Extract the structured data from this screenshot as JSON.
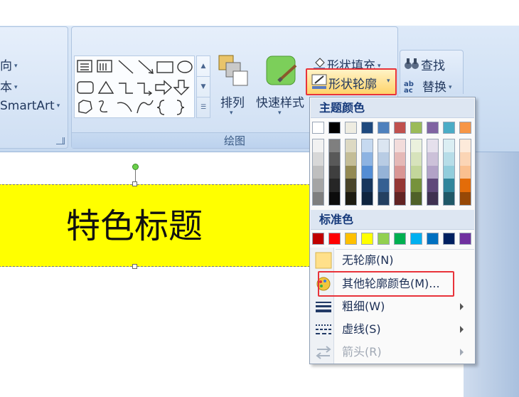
{
  "ribbon": {
    "left_group": {
      "items": [
        "向",
        "本",
        "SmartArt"
      ]
    },
    "drawing_group": {
      "caption": "绘图",
      "arrange_label": "排列",
      "quick_styles_label": "快速样式",
      "shape_fill_label": "形状填充",
      "shape_outline_label": "形状轮廓"
    },
    "editing_group": {
      "find_label": "查找",
      "replace_label": "替换"
    }
  },
  "slide": {
    "title_text": "特色标题",
    "title_fill": "#ffff00"
  },
  "dropdown": {
    "theme_colors_header": "主题颜色",
    "standard_colors_header": "标准色",
    "theme_colors": [
      "#ffffff",
      "#000000",
      "#eeece1",
      "#1f497d",
      "#4f81bd",
      "#c0504d",
      "#9bbb59",
      "#8064a2",
      "#4bacc6",
      "#f79646"
    ],
    "theme_tints": [
      [
        "#f2f2f2",
        "#d8d8d8",
        "#bfbfbf",
        "#a5a5a5",
        "#7f7f7f"
      ],
      [
        "#7f7f7f",
        "#595959",
        "#3f3f3f",
        "#262626",
        "#0c0c0c"
      ],
      [
        "#ddd9c3",
        "#c4bd97",
        "#938953",
        "#494429",
        "#1d1b10"
      ],
      [
        "#c6d9f0",
        "#8db3e2",
        "#548dd4",
        "#17365d",
        "#0f243e"
      ],
      [
        "#dbe5f1",
        "#b8cce4",
        "#95b3d7",
        "#366092",
        "#244061"
      ],
      [
        "#f2dcdb",
        "#e5b9b7",
        "#d99694",
        "#953734",
        "#632423"
      ],
      [
        "#ebf1dd",
        "#d7e3bc",
        "#c3d69b",
        "#76923c",
        "#4f6128"
      ],
      [
        "#e5e0ec",
        "#ccc1d9",
        "#b2a2c7",
        "#5f497a",
        "#3f3151"
      ],
      [
        "#dbeef3",
        "#b7dde8",
        "#92cddc",
        "#31859b",
        "#205867"
      ],
      [
        "#fdeada",
        "#fbd5b5",
        "#fac08f",
        "#e36c09",
        "#974806"
      ]
    ],
    "standard_colors": [
      "#c00000",
      "#ff0000",
      "#ffc000",
      "#ffff00",
      "#92d050",
      "#00b050",
      "#00b0f0",
      "#0070c0",
      "#002060",
      "#7030a0"
    ],
    "items": {
      "no_outline": "无轮廓(N)",
      "more_colors": "其他轮廓颜色(M)...",
      "weight": "粗细(W)",
      "dashes": "虚线(S)",
      "arrows": "箭头(R)"
    }
  }
}
